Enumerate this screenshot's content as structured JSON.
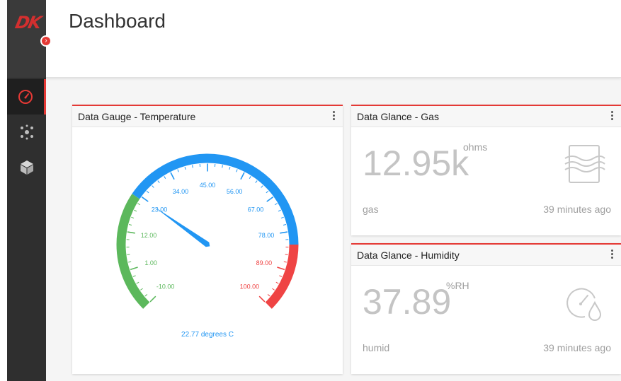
{
  "app": {
    "logo": "DK",
    "collapse_icon": "chevron-right-icon"
  },
  "header": {
    "title": "Dashboard"
  },
  "sidebar": {
    "items": [
      {
        "icon": "dashboard-gauge-icon",
        "active": true
      },
      {
        "icon": "network-nodes-icon",
        "active": false
      },
      {
        "icon": "cube-icon",
        "active": false
      }
    ]
  },
  "colors": {
    "accent": "#e53935",
    "gauge_low": "#5cb85c",
    "gauge_mid": "#2196f3",
    "gauge_high": "#ef4444",
    "needle": "#2196f3"
  },
  "gauge": {
    "title": "Data Gauge - Temperature",
    "value": 22.77,
    "caption": "22.77 degrees C",
    "min": -10,
    "max": 100,
    "ticks": [
      "-10.00",
      "1.00",
      "12.00",
      "23.00",
      "34.00",
      "45.00",
      "56.00",
      "67.00",
      "78.00",
      "89.00",
      "100.00"
    ]
  },
  "glance_gas": {
    "title": "Data Glance - Gas",
    "value": "12.95k",
    "unit": "ohms",
    "feed": "gas",
    "updated": "39 minutes ago",
    "icon": "gas-waves-icon"
  },
  "glance_humidity": {
    "title": "Data Glance - Humidity",
    "value": "37.89",
    "unit": "%RH",
    "feed": "humid",
    "updated": "39 minutes ago",
    "icon": "humidity-gauge-icon"
  }
}
